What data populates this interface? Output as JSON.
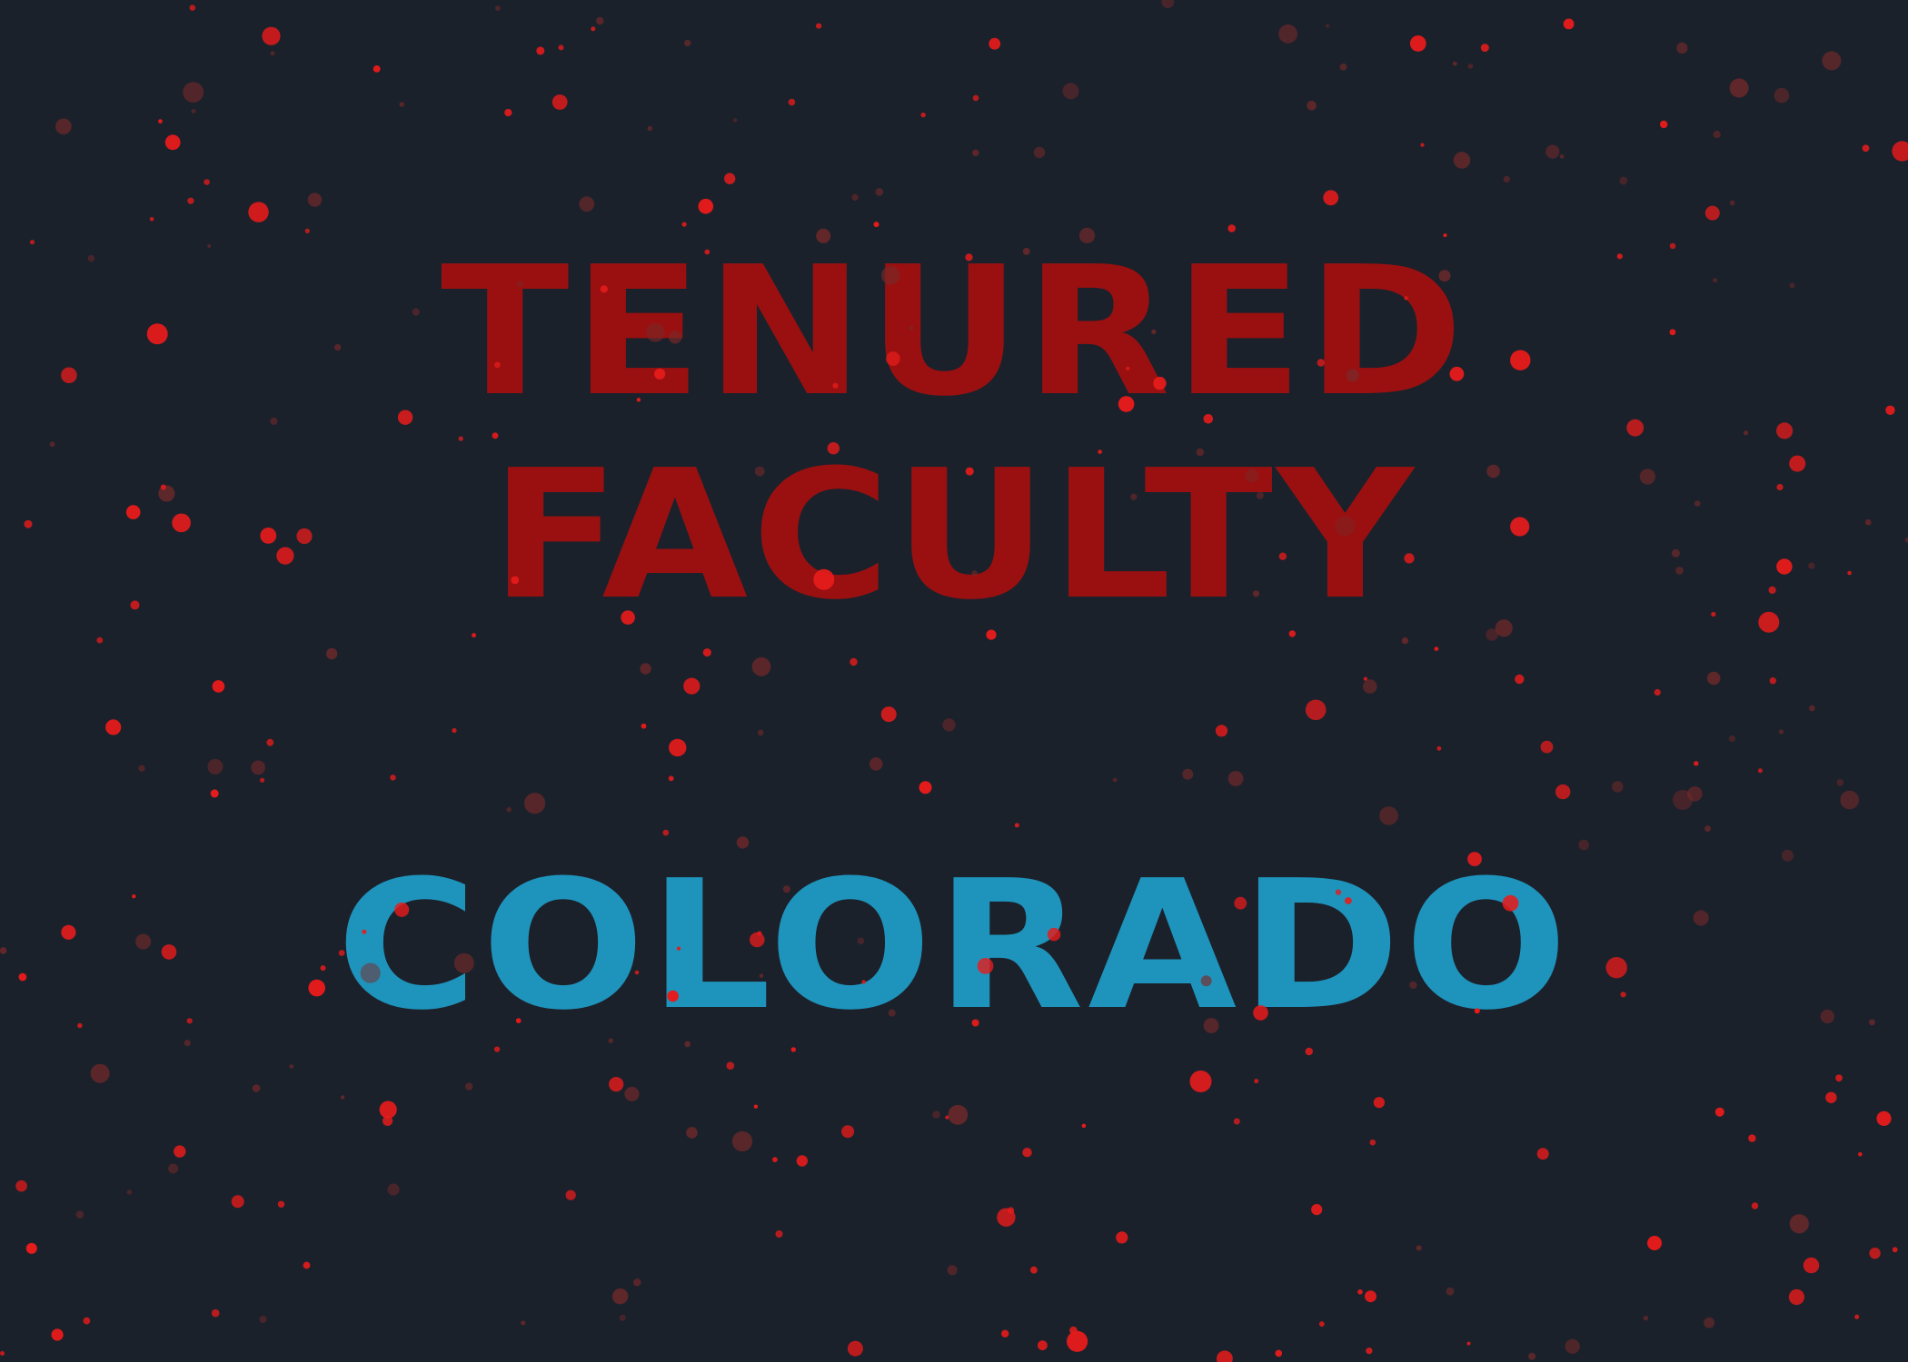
{
  "title": {
    "line1": "TENURED",
    "line2": "FACULTY",
    "line3": "COLORADO"
  },
  "colors": {
    "background": "#1b212b",
    "headline_red": "#9a1010",
    "headline_blue": "#1e94bd",
    "dot_bright": "#e61b1b",
    "dot_muted": "#7a2a2a"
  },
  "decoration": {
    "style": "scattered red dots"
  }
}
